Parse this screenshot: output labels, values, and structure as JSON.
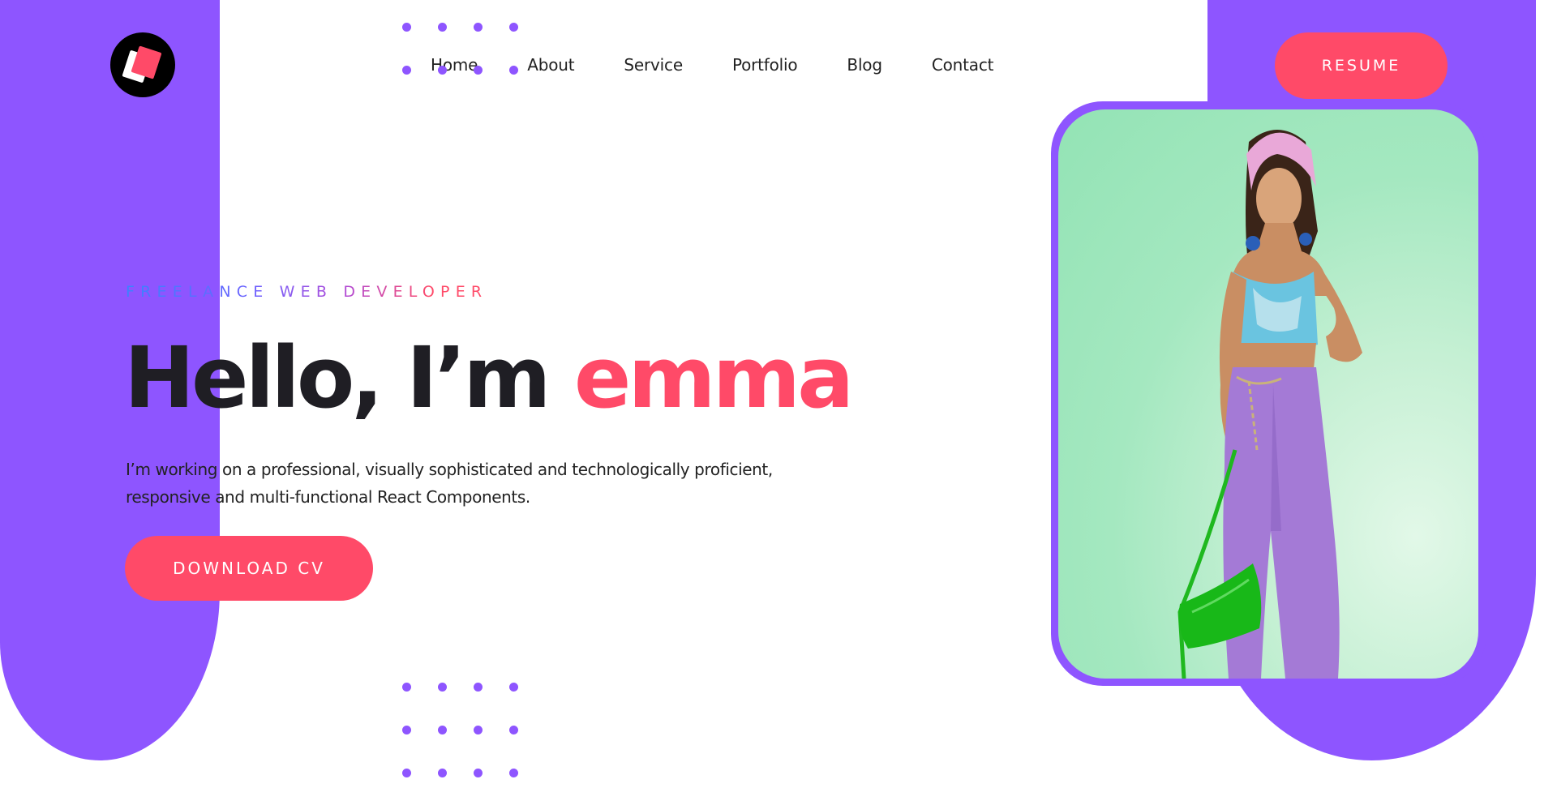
{
  "brand": {
    "logo_icon": "stacked-squares-logo"
  },
  "nav": {
    "items": [
      {
        "label": "Home"
      },
      {
        "label": "About"
      },
      {
        "label": "Service"
      },
      {
        "label": "Portfolio"
      },
      {
        "label": "Blog"
      },
      {
        "label": "Contact"
      }
    ]
  },
  "header": {
    "resume_label": "RESUME"
  },
  "hero": {
    "eyebrow": "FREELANCE WEB DEVELOPER",
    "title_prefix": "Hello, I’m ",
    "title_name": "emma",
    "description": "I’m working on a professional, visually sophisticated and technologically proficient, responsive and multi-functional React Components.",
    "cta_label": "DOWNLOAD CV",
    "photo_alt": "Portrait of emma in purple cargo pants holding a green bag"
  },
  "colors": {
    "primary_purple": "#8e55ff",
    "accent_pink": "#ff4a68",
    "text_dark": "#1f1e24",
    "eyebrow_gradient": [
      "#3b82ff",
      "#6e63ff",
      "#b04cd8",
      "#ff4a68"
    ],
    "photo_background": "#a4e8c0"
  }
}
